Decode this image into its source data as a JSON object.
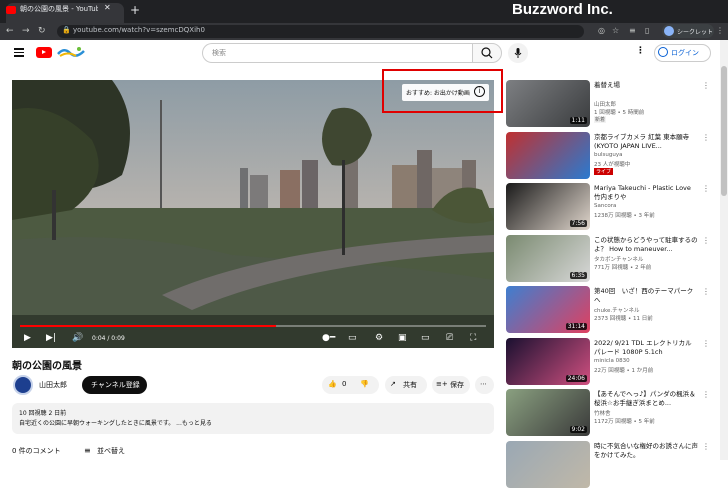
{
  "browser": {
    "tab_title": "朝の公園の風景 - YouTube",
    "url": "youtube.com/watch?v=szemcDQXih0",
    "brand": "Buzzword Inc.",
    "profile_label": "シークレット"
  },
  "header": {
    "search_placeholder": "検索",
    "login_label": "ログイン"
  },
  "player": {
    "overlay_label": "おすすめ: お出かけ動画",
    "time": "0:04 / 0:09",
    "progress": 0.55
  },
  "video": {
    "title": "朝の公園の風景",
    "channel": "山田太郎",
    "subscribe_label": "チャンネル登録",
    "likes": "0",
    "share_label": "共有",
    "save_label": "保存",
    "desc_meta": "10 回視聴  2 日前",
    "desc_text": "自宅近くの公園に早朝ウォーキングしたときに風景です。 ...もっと見る",
    "comments": "0 件のコメント",
    "sort_label": "並べ替え"
  },
  "sidebar": [
    {
      "title": "着替え場",
      "channel": "山田太郎",
      "meta": "1 回視聴 • 5 時間前",
      "badge": "新着",
      "duration": "1:11"
    },
    {
      "title": "京都ライブカメラ 紅葉 東本願寺 (KYOTO JAPAN LIVE...",
      "channel": "bulsuguya",
      "meta": "23 人が視聴中",
      "live": "ライブ",
      "duration": ""
    },
    {
      "title": "Mariya Takeuchi - Plastic Love 竹内まりや",
      "channel": "Sancora",
      "meta": "1238万 回視聴 • 3 年前",
      "duration": "7:56"
    },
    {
      "title": "この状態からどうやって駐車するのよ？ How to maneuver...",
      "channel": "タカボンチャンネル",
      "meta": "771万 回視聴 • 2 年前",
      "duration": "6:35"
    },
    {
      "title": "第40回　いざ！西のテーマパークへ",
      "channel": "chuke.チャンネル",
      "meta": "2373 回視聴 • 11 日前",
      "duration": "31:14"
    },
    {
      "title": "2022/ 9/21 TDL エレクトリカルパレード 1080P 5.1ch",
      "channel": "minicla 0830",
      "meta": "22万 回視聴 • 1 か月前",
      "duration": "24:06"
    },
    {
      "title": "【あそんでへっ♪】パンダの楓浜＆桜浜☆お手継ぎ浜まとめ...",
      "channel": "竹林舎",
      "meta": "1172万 回視聴 • 5 年前",
      "duration": "9:02"
    },
    {
      "title": "時に不気合いな権好のお誘さんに声をかけてみた。",
      "channel": "",
      "meta": "",
      "duration": ""
    }
  ]
}
